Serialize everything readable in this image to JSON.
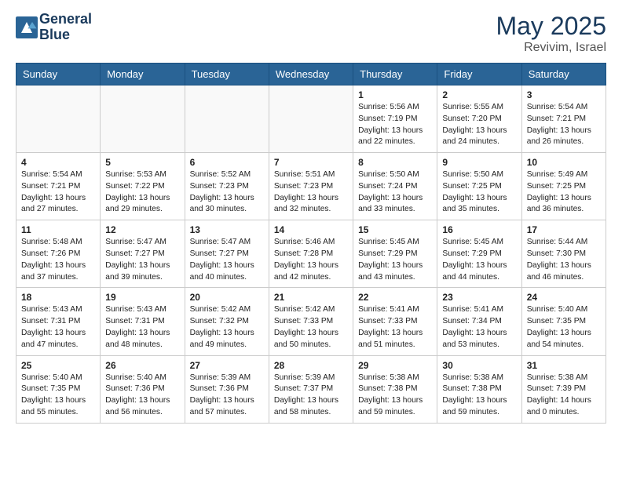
{
  "header": {
    "logo_line1": "General",
    "logo_line2": "Blue",
    "month": "May 2025",
    "location": "Revivim, Israel"
  },
  "weekdays": [
    "Sunday",
    "Monday",
    "Tuesday",
    "Wednesday",
    "Thursday",
    "Friday",
    "Saturday"
  ],
  "weeks": [
    [
      {
        "day": "",
        "text": ""
      },
      {
        "day": "",
        "text": ""
      },
      {
        "day": "",
        "text": ""
      },
      {
        "day": "",
        "text": ""
      },
      {
        "day": "1",
        "text": "Sunrise: 5:56 AM\nSunset: 7:19 PM\nDaylight: 13 hours\nand 22 minutes."
      },
      {
        "day": "2",
        "text": "Sunrise: 5:55 AM\nSunset: 7:20 PM\nDaylight: 13 hours\nand 24 minutes."
      },
      {
        "day": "3",
        "text": "Sunrise: 5:54 AM\nSunset: 7:21 PM\nDaylight: 13 hours\nand 26 minutes."
      }
    ],
    [
      {
        "day": "4",
        "text": "Sunrise: 5:54 AM\nSunset: 7:21 PM\nDaylight: 13 hours\nand 27 minutes."
      },
      {
        "day": "5",
        "text": "Sunrise: 5:53 AM\nSunset: 7:22 PM\nDaylight: 13 hours\nand 29 minutes."
      },
      {
        "day": "6",
        "text": "Sunrise: 5:52 AM\nSunset: 7:23 PM\nDaylight: 13 hours\nand 30 minutes."
      },
      {
        "day": "7",
        "text": "Sunrise: 5:51 AM\nSunset: 7:23 PM\nDaylight: 13 hours\nand 32 minutes."
      },
      {
        "day": "8",
        "text": "Sunrise: 5:50 AM\nSunset: 7:24 PM\nDaylight: 13 hours\nand 33 minutes."
      },
      {
        "day": "9",
        "text": "Sunrise: 5:50 AM\nSunset: 7:25 PM\nDaylight: 13 hours\nand 35 minutes."
      },
      {
        "day": "10",
        "text": "Sunrise: 5:49 AM\nSunset: 7:25 PM\nDaylight: 13 hours\nand 36 minutes."
      }
    ],
    [
      {
        "day": "11",
        "text": "Sunrise: 5:48 AM\nSunset: 7:26 PM\nDaylight: 13 hours\nand 37 minutes."
      },
      {
        "day": "12",
        "text": "Sunrise: 5:47 AM\nSunset: 7:27 PM\nDaylight: 13 hours\nand 39 minutes."
      },
      {
        "day": "13",
        "text": "Sunrise: 5:47 AM\nSunset: 7:27 PM\nDaylight: 13 hours\nand 40 minutes."
      },
      {
        "day": "14",
        "text": "Sunrise: 5:46 AM\nSunset: 7:28 PM\nDaylight: 13 hours\nand 42 minutes."
      },
      {
        "day": "15",
        "text": "Sunrise: 5:45 AM\nSunset: 7:29 PM\nDaylight: 13 hours\nand 43 minutes."
      },
      {
        "day": "16",
        "text": "Sunrise: 5:45 AM\nSunset: 7:29 PM\nDaylight: 13 hours\nand 44 minutes."
      },
      {
        "day": "17",
        "text": "Sunrise: 5:44 AM\nSunset: 7:30 PM\nDaylight: 13 hours\nand 46 minutes."
      }
    ],
    [
      {
        "day": "18",
        "text": "Sunrise: 5:43 AM\nSunset: 7:31 PM\nDaylight: 13 hours\nand 47 minutes."
      },
      {
        "day": "19",
        "text": "Sunrise: 5:43 AM\nSunset: 7:31 PM\nDaylight: 13 hours\nand 48 minutes."
      },
      {
        "day": "20",
        "text": "Sunrise: 5:42 AM\nSunset: 7:32 PM\nDaylight: 13 hours\nand 49 minutes."
      },
      {
        "day": "21",
        "text": "Sunrise: 5:42 AM\nSunset: 7:33 PM\nDaylight: 13 hours\nand 50 minutes."
      },
      {
        "day": "22",
        "text": "Sunrise: 5:41 AM\nSunset: 7:33 PM\nDaylight: 13 hours\nand 51 minutes."
      },
      {
        "day": "23",
        "text": "Sunrise: 5:41 AM\nSunset: 7:34 PM\nDaylight: 13 hours\nand 53 minutes."
      },
      {
        "day": "24",
        "text": "Sunrise: 5:40 AM\nSunset: 7:35 PM\nDaylight: 13 hours\nand 54 minutes."
      }
    ],
    [
      {
        "day": "25",
        "text": "Sunrise: 5:40 AM\nSunset: 7:35 PM\nDaylight: 13 hours\nand 55 minutes."
      },
      {
        "day": "26",
        "text": "Sunrise: 5:40 AM\nSunset: 7:36 PM\nDaylight: 13 hours\nand 56 minutes."
      },
      {
        "day": "27",
        "text": "Sunrise: 5:39 AM\nSunset: 7:36 PM\nDaylight: 13 hours\nand 57 minutes."
      },
      {
        "day": "28",
        "text": "Sunrise: 5:39 AM\nSunset: 7:37 PM\nDaylight: 13 hours\nand 58 minutes."
      },
      {
        "day": "29",
        "text": "Sunrise: 5:38 AM\nSunset: 7:38 PM\nDaylight: 13 hours\nand 59 minutes."
      },
      {
        "day": "30",
        "text": "Sunrise: 5:38 AM\nSunset: 7:38 PM\nDaylight: 13 hours\nand 59 minutes."
      },
      {
        "day": "31",
        "text": "Sunrise: 5:38 AM\nSunset: 7:39 PM\nDaylight: 14 hours\nand 0 minutes."
      }
    ]
  ]
}
